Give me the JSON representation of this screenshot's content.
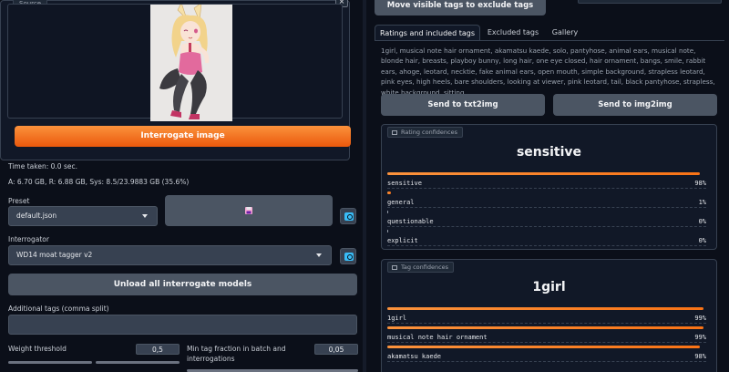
{
  "left": {
    "source_label": "Source",
    "close_symbol": "×",
    "interrogate_button": "Interrogate image",
    "time_taken": "Time taken: 0.0 sec.",
    "memory": "A: 6.70 GB, R: 6.88 GB, Sys: 8.5/23.9883 GB (35.6%)",
    "preset_label": "Preset",
    "preset_value": "default.json",
    "interrogator_label": "Interrogator",
    "interrogator_value": "WD14 moat tagger v2",
    "unload_button": "Unload all interrogate models",
    "additional_tags_label": "Additional tags (comma split)",
    "weight_threshold_label": "Weight threshold",
    "weight_threshold_value": "0,5",
    "min_tag_label_1": "Min tag fraction in batch and",
    "min_tag_label_2": "interrogations",
    "min_tag_value": "0,05"
  },
  "right": {
    "move_tags_button": "Move visible tags to exclude tags",
    "tabs": [
      {
        "label": "Ratings and included tags"
      },
      {
        "label": "Excluded tags"
      },
      {
        "label": "Gallery"
      }
    ],
    "tags_text": "1girl, musical note hair ornament, akamatsu kaede, solo, pantyhose, animal ears, musical note, blonde hair, breasts, playboy bunny, long hair, one eye closed, hair ornament, bangs, smile, rabbit ears, ahoge, leotard, necktie, fake animal ears, open mouth, simple background, strapless leotard, pink eyes, high heels, bare shoulders, looking at viewer, pink leotard, tail, black pantyhose, strapless, white background, sitting",
    "send_txt2img": "Send to txt2img",
    "send_img2img": "Send to img2img",
    "rating_panel": {
      "label": "Rating confidences",
      "title": "sensitive",
      "items": [
        {
          "name": "sensitive",
          "value": "98%",
          "fraction": 0.98
        },
        {
          "name": "general",
          "value": "1%",
          "fraction": 0.01
        },
        {
          "name": "questionable",
          "value": "0%",
          "fraction": 0.0
        },
        {
          "name": "explicit",
          "value": "0%",
          "fraction": 0.0
        }
      ]
    },
    "tag_panel": {
      "label": "Tag confidences",
      "title": "1girl",
      "items": [
        {
          "name": "1girl",
          "value": "99%",
          "fraction": 0.99
        },
        {
          "name": "musical note hair ornament",
          "value": "99%",
          "fraction": 0.99
        },
        {
          "name": "akamatsu kaede",
          "value": "98%",
          "fraction": 0.98
        }
      ]
    }
  },
  "colors": {
    "accent_orange": "#f97316",
    "background": "#0b0f19",
    "panel": "#1f2937"
  }
}
